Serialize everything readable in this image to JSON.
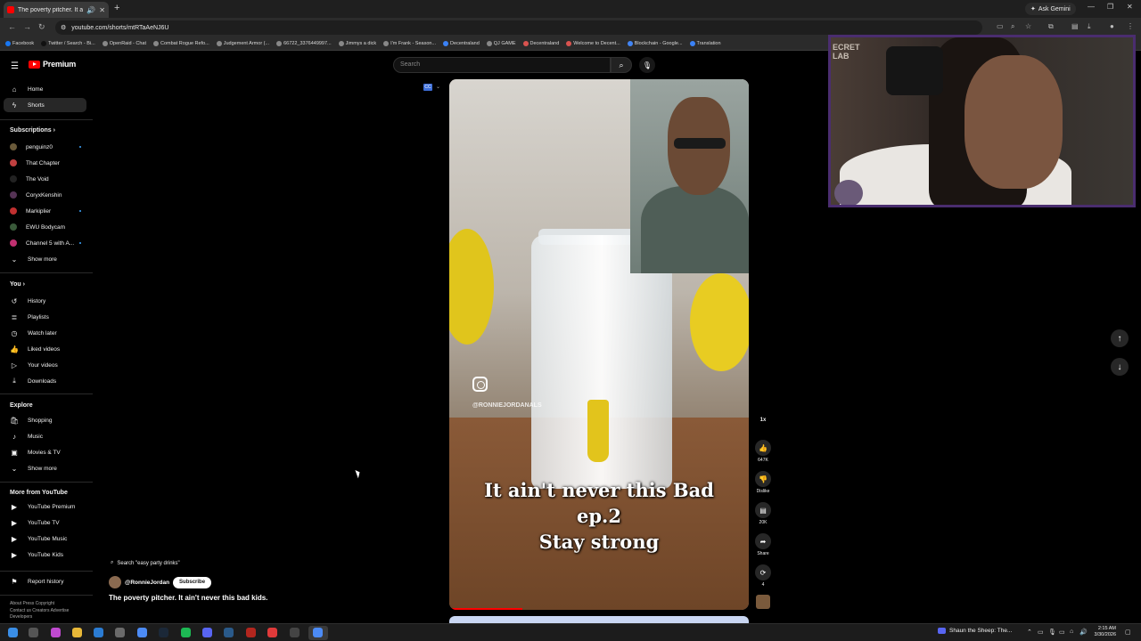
{
  "browser": {
    "tab_title": "The poverty pitcher. It ain't...",
    "new_tab": "+",
    "ask_gemini": "Ask Gemini",
    "url": "youtube.com/shorts/mtRTaAeNJ6U",
    "bookmarks": [
      "Facebook",
      "Twitter / Search - Bi...",
      "OpenRaid - Chat",
      "Combat Rogue Refo...",
      "Judgement Armor (...",
      "66722_3376449997...",
      "Jimmys a dick",
      "I'm Frank - Season...",
      "Decentraland",
      "QJ GAME",
      "Decentraland",
      "Welcome to Decent...",
      "Blockchain - Google...",
      "Translation"
    ]
  },
  "youtube": {
    "logo_text": "Premium",
    "search_placeholder": "Search"
  },
  "sidebar": {
    "main": [
      {
        "label": "Home",
        "icon": "home-icon"
      },
      {
        "label": "Shorts",
        "icon": "shorts-icon",
        "active": true
      }
    ],
    "subscriptions_title": "Subscriptions",
    "subscriptions": [
      {
        "label": "penguinz0",
        "live": true
      },
      {
        "label": "That Chapter"
      },
      {
        "label": "The Void"
      },
      {
        "label": "CoryxKenshin"
      },
      {
        "label": "Markiplier",
        "live": true
      },
      {
        "label": "EWU Bodycam"
      },
      {
        "label": "Channel 5 with A...",
        "live": true
      }
    ],
    "show_more": "Show more",
    "you_title": "You",
    "you_items": [
      {
        "label": "History",
        "icon": "history-icon"
      },
      {
        "label": "Playlists",
        "icon": "playlists-icon"
      },
      {
        "label": "Watch later",
        "icon": "watch-later-icon"
      },
      {
        "label": "Liked videos",
        "icon": "liked-icon"
      },
      {
        "label": "Your videos",
        "icon": "your-videos-icon"
      },
      {
        "label": "Downloads",
        "icon": "downloads-icon"
      }
    ],
    "explore_title": "Explore",
    "explore_items": [
      {
        "label": "Shopping",
        "icon": "shopping-icon"
      },
      {
        "label": "Music",
        "icon": "music-icon"
      },
      {
        "label": "Movies & TV",
        "icon": "movies-icon"
      }
    ],
    "explore_show_more": "Show more",
    "more_title": "More from YouTube",
    "more_items": [
      {
        "label": "YouTube Premium"
      },
      {
        "label": "YouTube TV"
      },
      {
        "label": "YouTube Music"
      },
      {
        "label": "YouTube Kids"
      }
    ],
    "report": "Report history",
    "footer_line1": "About  Press  Copyright",
    "footer_line2": "Contact us  Creators  Advertise",
    "footer_line3": "Developers"
  },
  "short": {
    "ig_handle": "@RONNIEJORDANALS",
    "caption_line1": "It ain't never this Bad",
    "caption_line2": "ep.2",
    "caption_line3": "Stay strong",
    "search_chip": "Search \"easy party drinks\"",
    "channel": "@RonnieJordan",
    "subscribe": "Subscribe",
    "title": "The poverty pitcher. It ain't never this bad kids.",
    "speed": "1x",
    "likes": "647K",
    "dislike": "Dislike",
    "comments": "20K",
    "share": "Share",
    "remix": "4"
  },
  "webcam": {
    "sign_text": "ECRET\nLAB"
  },
  "taskbar": {
    "media_title": "Shaun the Sheep: The...",
    "time": "2:15 AM",
    "date": "3/30/2026"
  }
}
